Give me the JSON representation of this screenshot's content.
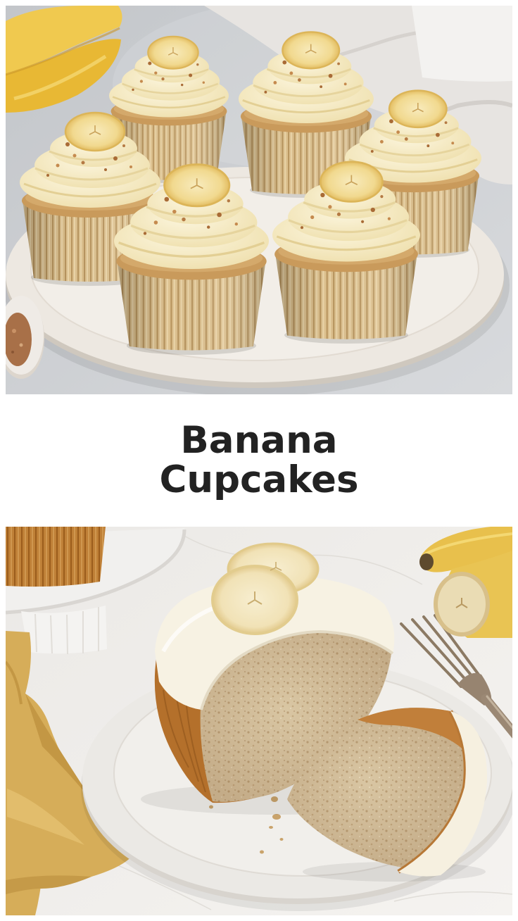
{
  "title": {
    "line1": "Banana",
    "line2": "Cupcakes"
  },
  "colors": {
    "page_background": "#ffffff",
    "title_text": "#222222"
  }
}
